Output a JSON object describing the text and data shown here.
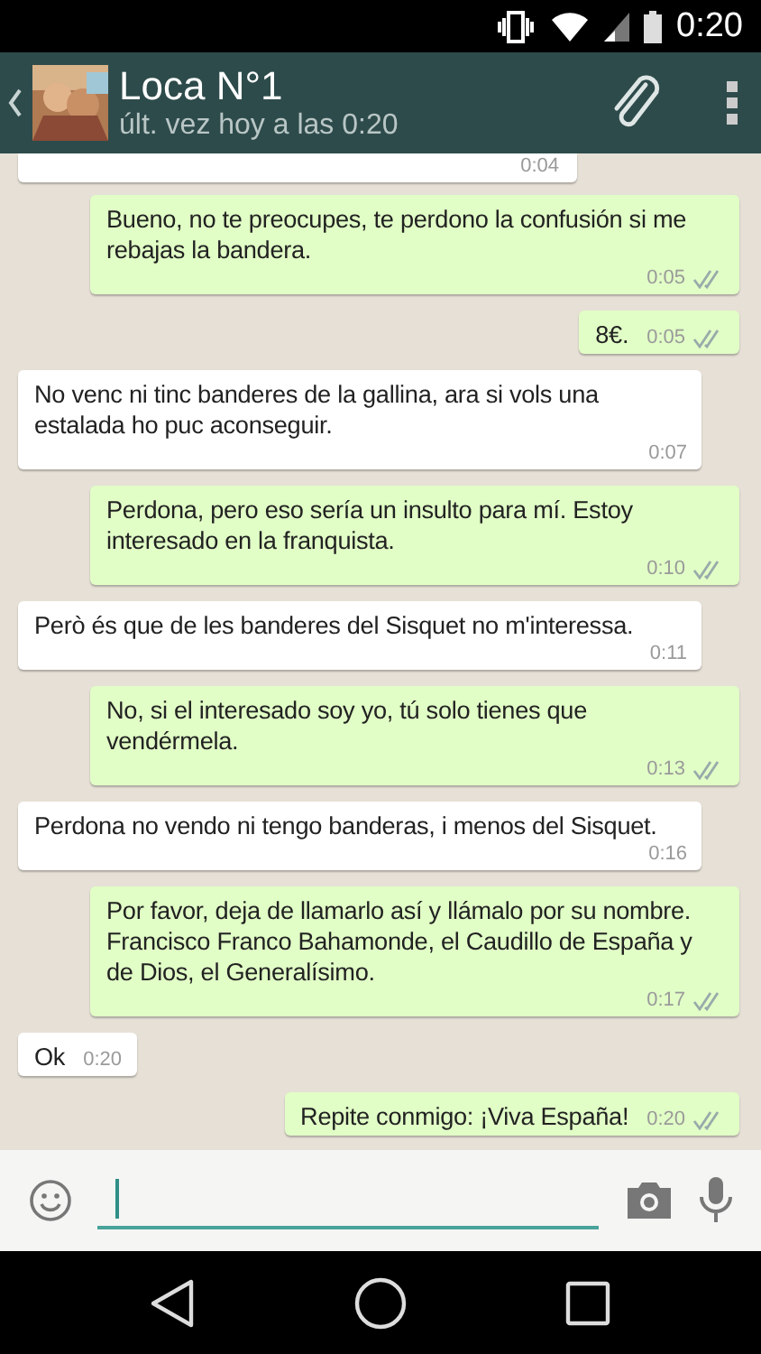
{
  "status_bar": {
    "time": "0:20"
  },
  "header": {
    "name": "Loca N°1",
    "last_seen": "últ. vez hoy a las 0:20"
  },
  "messages": [
    {
      "kind": "cut",
      "time": "0:04"
    },
    {
      "kind": "out",
      "text": "Bueno, no te preocupes, te perdono la confusión si me rebajas la bandera.",
      "time": "0:05"
    },
    {
      "kind": "out",
      "text": "8€.",
      "time": "0:05"
    },
    {
      "kind": "in",
      "text": "No venc ni tinc banderes de la gallina, ara si vols una estalada ho puc aconseguir.",
      "time": "0:07"
    },
    {
      "kind": "out",
      "text": "Perdona, pero eso sería un insulto para mí. Estoy interesado en la franquista.",
      "time": "0:10"
    },
    {
      "kind": "in",
      "text": "Però és que de les banderes del Sisquet no m'interessa.",
      "time": "0:11"
    },
    {
      "kind": "out",
      "text": "No, si el interesado soy yo, tú solo tienes que vendérmela.",
      "time": "0:13"
    },
    {
      "kind": "in",
      "text": "Perdona no vendo ni tengo banderas, i menos del Sisquet.",
      "time": "0:16"
    },
    {
      "kind": "out",
      "text": "Por favor, deja de llamarlo así y llámalo por su nombre. Francisco Franco Bahamonde, el Caudillo de España y de Dios, el Generalísimo.",
      "time": "0:17"
    },
    {
      "kind": "in",
      "text": "Ok",
      "time": "0:20"
    },
    {
      "kind": "out",
      "text": "Repite conmigo: ¡Viva España!",
      "time": "0:20"
    }
  ]
}
